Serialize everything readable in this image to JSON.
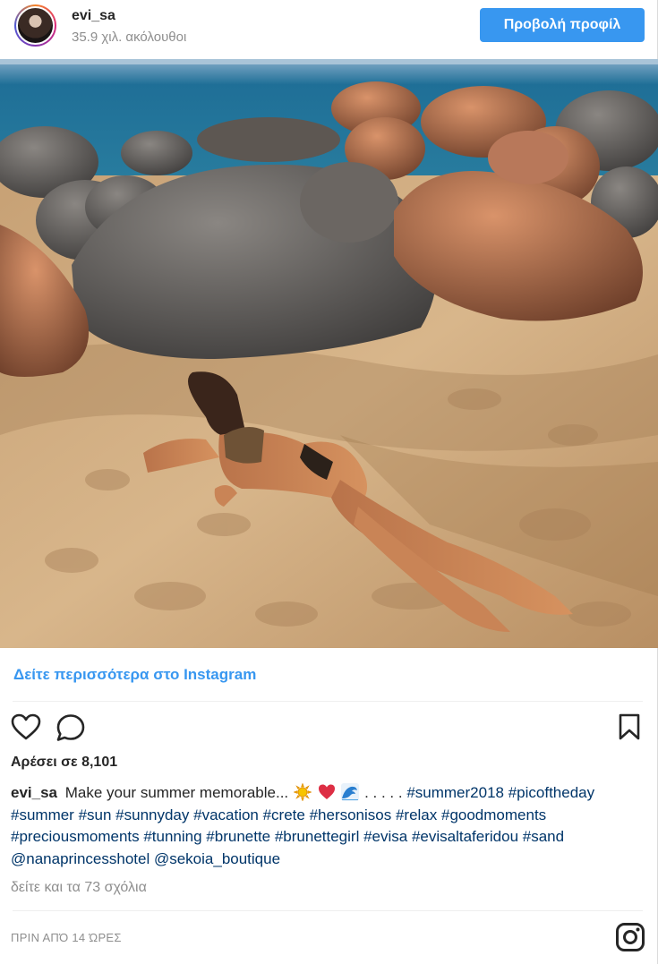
{
  "header": {
    "username": "evi_sa",
    "followers": "35.9 χιλ. ακόλουθοι",
    "view_profile_label": "Προβολή προφίλ"
  },
  "post": {
    "more_link": "Δείτε περισσότερα στο Instagram",
    "likes": "Αρέσει σε 8,101",
    "caption": {
      "username": "evi_sa",
      "text_before_emoji": "Make your summer memorable...",
      "text_after_emoji": ". . . . .",
      "hashtags_line1": "#summer2018 #picoftheday",
      "hashtags_line2": "#summer #sun #sunnyday #vacation #crete #hersonisos #relax #goodmoments",
      "hashtags_line3": "#preciousmoments #tunning #brunette #brunettegirl #evisa #evisaltaferidou #sand",
      "mentions": "@nanaprincesshotel @sekoia_boutique"
    },
    "comments_link": "δείτε και τα 73 σχόλια",
    "timestamp": "ΠΡΙΝ ΑΠΌ 14 ΏΡΕΣ"
  },
  "icons": {
    "like": "heart-icon",
    "comment": "comment-icon",
    "save": "bookmark-icon",
    "brand": "instagram-icon",
    "emoji": [
      "sun-emoji-icon",
      "red-heart-emoji-icon",
      "wave-emoji-icon"
    ]
  },
  "colors": {
    "accent": "#3897f0",
    "hashtag": "#003569",
    "muted": "#8e8e8e"
  }
}
